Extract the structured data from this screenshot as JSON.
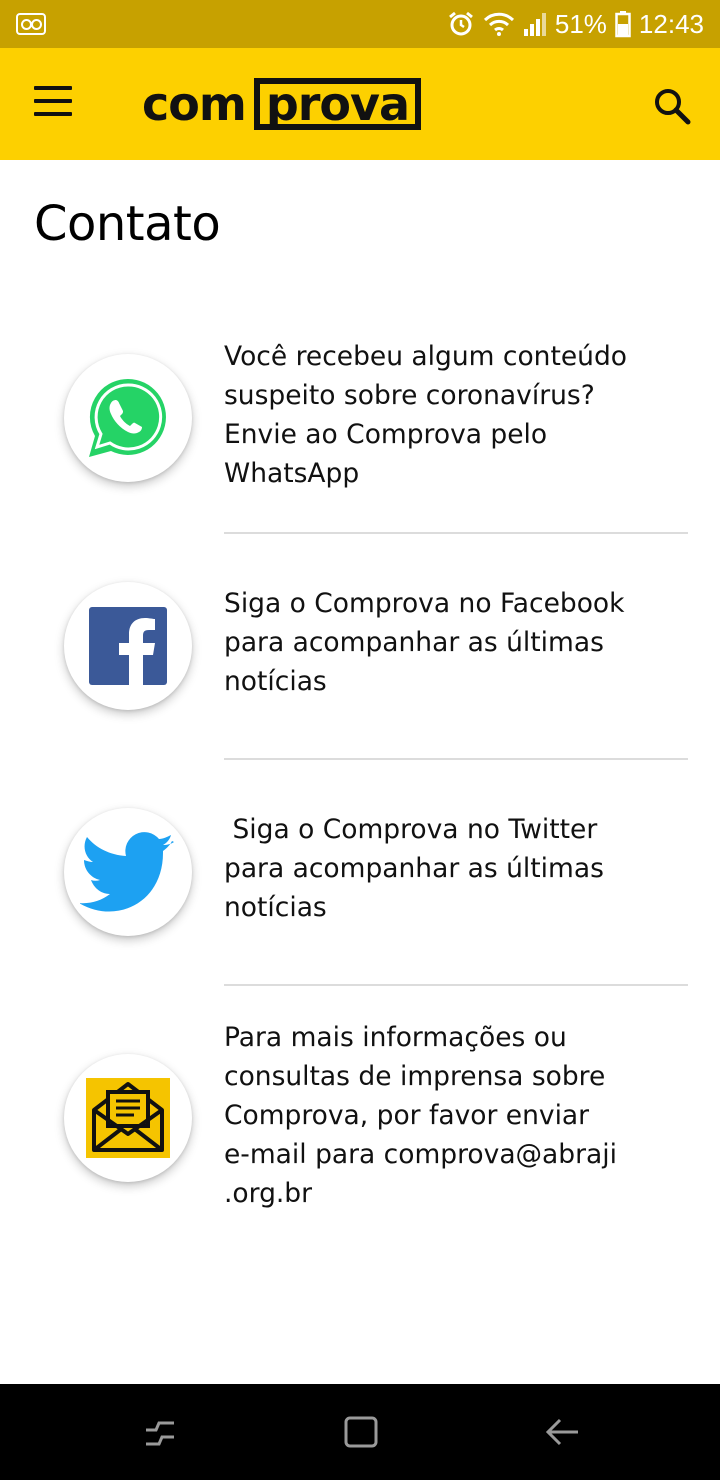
{
  "status_bar": {
    "battery": "51%",
    "time": "12:43",
    "icons": [
      "voicemail-icon",
      "alarm-icon",
      "wifi-icon",
      "signal-icon",
      "battery-icon"
    ]
  },
  "app_bar": {
    "logo_left": "com",
    "logo_right": "prova",
    "menu_icon": "hamburger-menu-icon",
    "search_icon": "search-icon",
    "accent_color": "#fdd000"
  },
  "page": {
    "title": "Contato"
  },
  "contacts": [
    {
      "icon": "whatsapp-icon",
      "text": "Você recebeu algum conteúdo\nsuspeito sobre coronavírus?\nEnvie ao Comprova pelo\nWhatsApp"
    },
    {
      "icon": "facebook-icon",
      "text": "Siga o Comprova no Facebook\npara acompanhar as últimas\nnotícias"
    },
    {
      "icon": "twitter-icon",
      "text": " Siga o Comprova no Twitter\npara acompanhar as últimas\nnotícias"
    },
    {
      "icon": "email-icon",
      "text": "Para mais informações ou\nconsultas de imprensa sobre\nComprova, por favor enviar\ne-mail para comprova@abraji\n.org.br"
    }
  ],
  "nav_bar": {
    "icons": [
      "recent-apps-icon",
      "home-icon",
      "back-icon"
    ]
  }
}
